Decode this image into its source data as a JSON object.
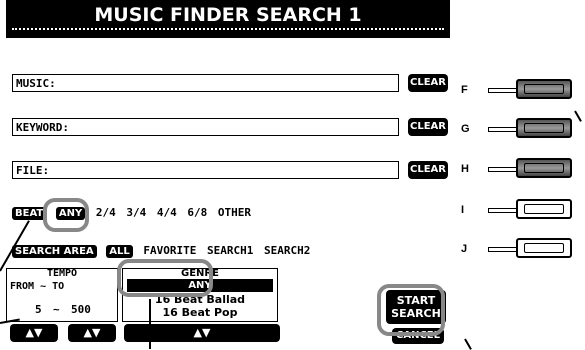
{
  "title": "MUSIC FINDER SEARCH 1",
  "fields": [
    {
      "label": "MUSIC:",
      "clear": "CLEAR"
    },
    {
      "label": "KEYWORD:",
      "clear": "CLEAR"
    },
    {
      "label": "FILE:",
      "clear": "CLEAR"
    }
  ],
  "beat": {
    "tag": "BEAT",
    "selected": "ANY",
    "options": [
      "2/4",
      "3/4",
      "4/4",
      "6/8",
      "OTHER"
    ]
  },
  "search_area": {
    "tag": "SEARCH AREA",
    "selected": "ALL",
    "options": [
      "FAVORITE",
      "SEARCH1",
      "SEARCH2"
    ]
  },
  "tempo": {
    "label": "TEMPO",
    "from_to": "FROM ~ TO",
    "from": "5",
    "sep": "~",
    "to": "500"
  },
  "genre": {
    "label": "GENRE",
    "selected": "ANY",
    "items": [
      "16 Beat Ballad",
      "16 Beat Pop"
    ]
  },
  "start_search": "START SEARCH",
  "cancel": "CANCEL",
  "bottom_buttons": {
    "tempo_arrows": "▲▼",
    "updown_1": "▲▼",
    "updown_2": "▲▼"
  },
  "side_buttons": [
    {
      "letter": "F",
      "style": "dark"
    },
    {
      "letter": "G",
      "style": "dark"
    },
    {
      "letter": "H",
      "style": "dark"
    },
    {
      "letter": "I",
      "style": "light"
    },
    {
      "letter": "J",
      "style": "light"
    }
  ]
}
